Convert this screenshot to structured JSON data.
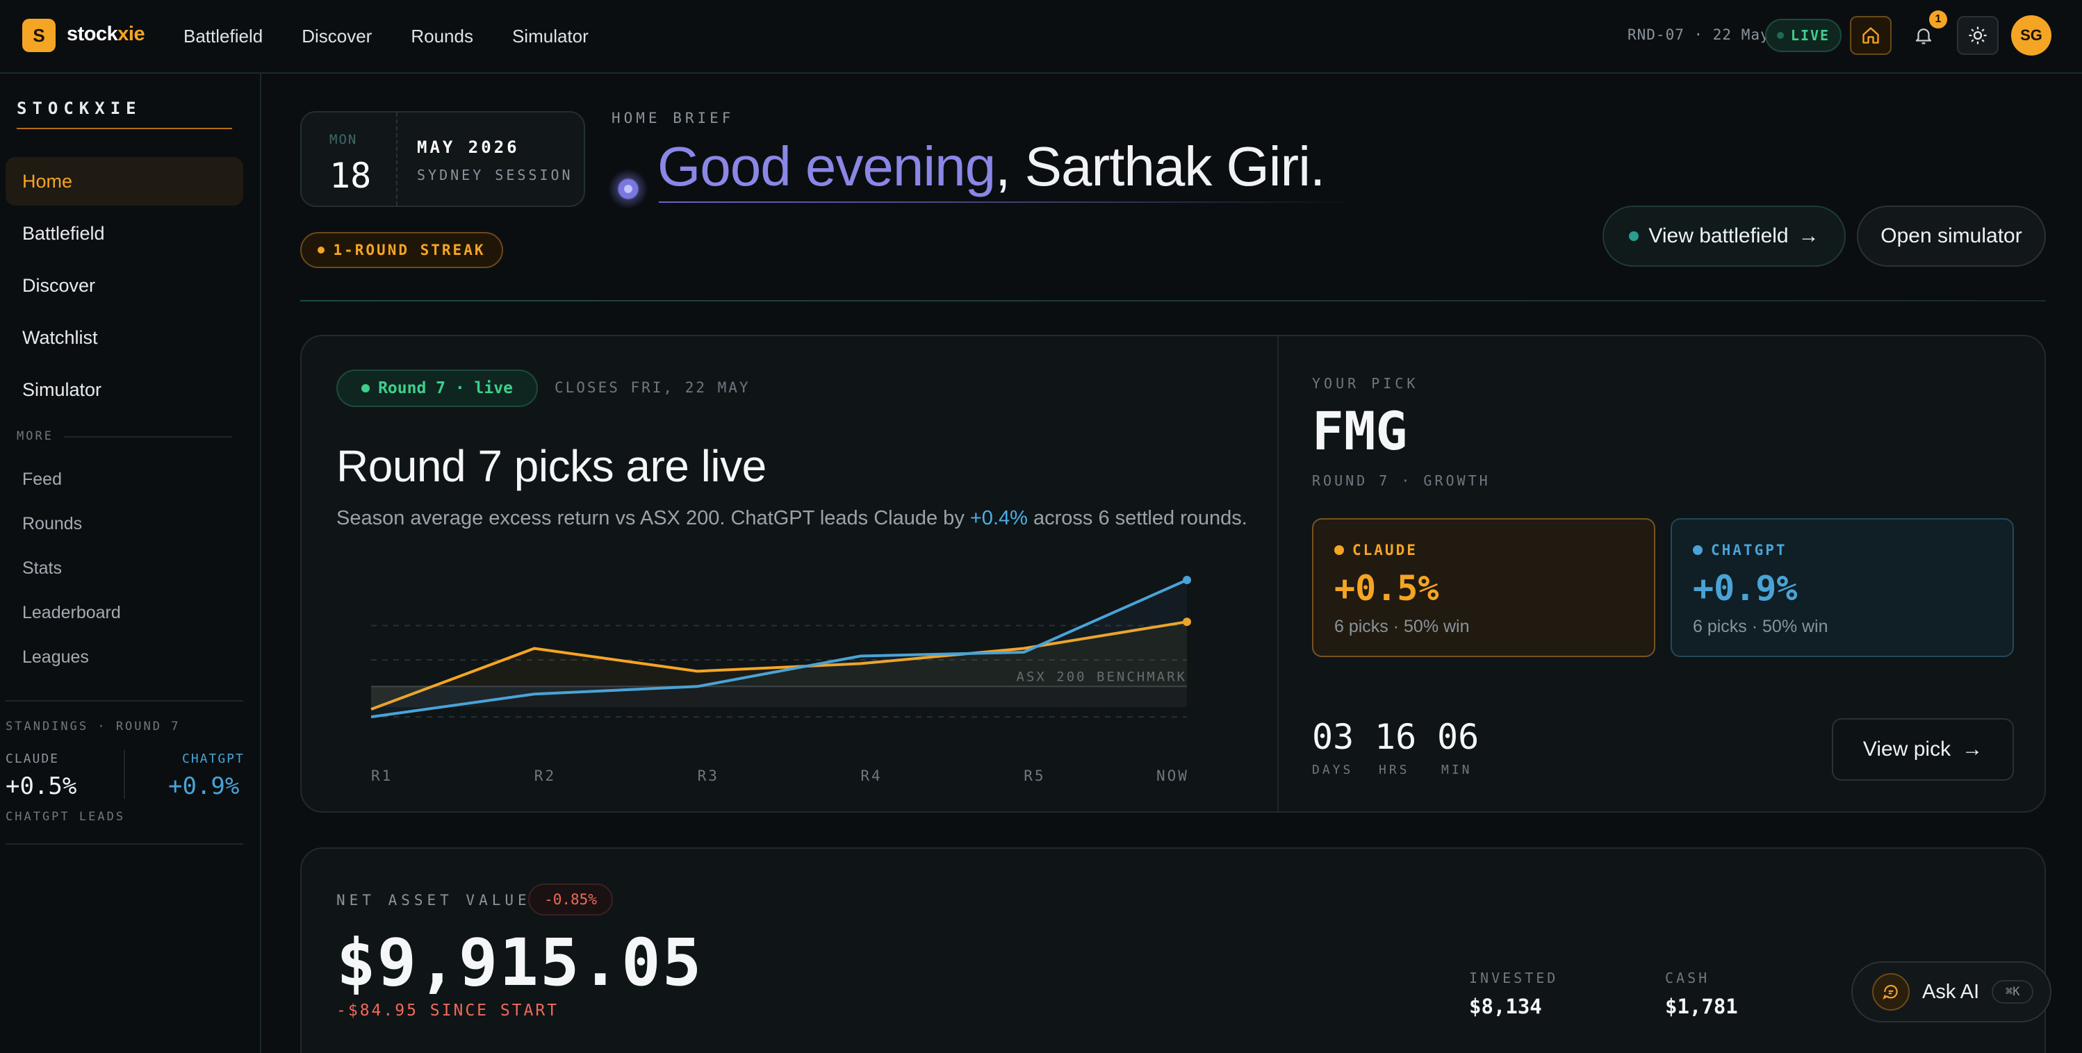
{
  "app": {
    "logo_letter": "S",
    "name_main": "stock",
    "name_accent": "xie",
    "brand_color": "#f5a524"
  },
  "topnav": {
    "items": [
      "Battlefield",
      "Discover",
      "Rounds",
      "Simulator"
    ],
    "round_meta": "RND-07 · 22 May",
    "live_label": "LIVE",
    "notification_count": "1",
    "avatar_initials": "SG",
    "icons": [
      "home-icon",
      "bell-icon",
      "sun-icon"
    ]
  },
  "sidebar": {
    "brand": "STOCKXIE",
    "primary": [
      {
        "label": "Home",
        "active": true
      },
      {
        "label": "Battlefield"
      },
      {
        "label": "Discover"
      },
      {
        "label": "Watchlist"
      },
      {
        "label": "Simulator"
      }
    ],
    "more_label": "MORE",
    "secondary": [
      "Feed",
      "Rounds",
      "Stats",
      "Leaderboard",
      "Leagues"
    ],
    "standings": {
      "heading": "STANDINGS · ROUND 7",
      "claude_label": "CLAUDE",
      "claude_value": "+0.5%",
      "chatgpt_label": "CHATGPT",
      "chatgpt_value": "+0.9%",
      "footer": "CHATGPT LEADS"
    }
  },
  "header": {
    "date": {
      "dow": "MON",
      "day": "18",
      "month_year": "MAY 2026",
      "session": "SYDNEY SESSION"
    },
    "streak": "1-ROUND STREAK",
    "brief_label": "HOME BRIEF",
    "greeting_part1": "Good evening",
    "greeting_part2": ", Sarthak Giri.",
    "btn_battlefield": "View battlefield",
    "btn_simulator": "Open simulator",
    "arrow": "→"
  },
  "round": {
    "pill": "Round 7 · live",
    "closes": "CLOSES FRI, 22 MAY",
    "title": "Round 7 picks are live",
    "subtitle_pre": "Season average excess return vs ASX 200. ChatGPT leads Claude by ",
    "subtitle_hl": "+0.4%",
    "subtitle_post": " across 6 settled rounds."
  },
  "chart_data": {
    "type": "line",
    "categories": [
      "R1",
      "R2",
      "R3",
      "R4",
      "R5",
      "NOW"
    ],
    "series": [
      {
        "name": "Claude",
        "color": "#f5a524",
        "values": [
          -0.3,
          0.5,
          0.2,
          0.3,
          0.5,
          0.85
        ]
      },
      {
        "name": "ChatGPT",
        "color": "#4aa3d6",
        "values": [
          -0.4,
          -0.1,
          0.0,
          0.4,
          0.45,
          1.4
        ]
      }
    ],
    "benchmark_label": "ASX 200 BENCHMARK",
    "benchmark_value": 0,
    "ylim": [
      -0.6,
      1.5
    ],
    "grid": true
  },
  "pick": {
    "label": "YOUR PICK",
    "ticker": "FMG",
    "meta": "ROUND 7 · GROWTH",
    "claude": {
      "name": "CLAUDE",
      "value": "+0.5%",
      "stats": "6 picks · 50% win",
      "color": "#f5a524"
    },
    "chatgpt": {
      "name": "CHATGPT",
      "value": "+0.9%",
      "stats": "6 picks · 50% win",
      "color": "#4aa3d6"
    },
    "countdown": [
      {
        "value": "03",
        "label": "DAYS"
      },
      {
        "value": "16",
        "label": "HRS"
      },
      {
        "value": "06",
        "label": "MIN"
      }
    ],
    "view_pick": "View pick",
    "arrow": "→"
  },
  "nav_card": {
    "label": "NET ASSET VALUE",
    "change": "-0.85%",
    "value": "$9,915.05",
    "since": "-$84.95 SINCE START",
    "invested_label": "INVESTED",
    "invested_value": "$8,134",
    "cash_label": "CASH",
    "cash_value": "$1,781"
  },
  "ask_ai": {
    "label": "Ask AI",
    "shortcut": "⌘K"
  }
}
